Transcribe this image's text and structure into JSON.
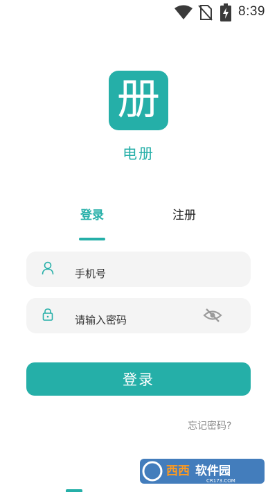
{
  "status_bar": {
    "time": "8:39",
    "icons": [
      "wifi-icon",
      "no-sim-icon",
      "battery-charging-icon"
    ]
  },
  "app": {
    "logo_glyph": "册",
    "name": "电册"
  },
  "tabs": [
    {
      "label": "登录",
      "active": true
    },
    {
      "label": "注册",
      "active": false
    }
  ],
  "form": {
    "phone_placeholder": "手机号",
    "password_placeholder": "请输入密码",
    "submit_label": "登录",
    "forgot_label": "忘记密码?"
  },
  "watermark": {
    "text": "西西软件园",
    "subtext": "CR173.COM"
  },
  "colors": {
    "accent": "#25afa8",
    "field_bg": "#f4f4f4",
    "muted_text": "#8a8a8a"
  }
}
